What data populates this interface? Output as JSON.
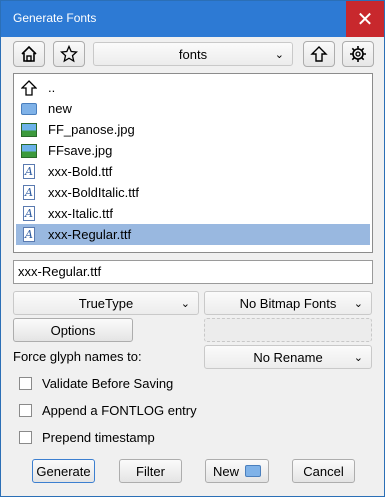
{
  "window": {
    "title": "Generate Fonts",
    "close_glyph": "✕"
  },
  "toolbar": {
    "home_icon": "home-icon",
    "bookmark_icon": "star-icon",
    "directory": "fonts",
    "up_icon": "arrow-up-icon",
    "settings_icon": "gear-icon"
  },
  "files": [
    {
      "name": "..",
      "type": "parent",
      "selected": false
    },
    {
      "name": "new",
      "type": "folder",
      "selected": false
    },
    {
      "name": "FF_panose.jpg",
      "type": "image",
      "selected": false
    },
    {
      "name": "FFsave.jpg",
      "type": "image",
      "selected": false
    },
    {
      "name": "xxx-Bold.ttf",
      "type": "font",
      "selected": false
    },
    {
      "name": "xxx-BoldItalic.ttf",
      "type": "font",
      "selected": false
    },
    {
      "name": "xxx-Italic.ttf",
      "type": "font",
      "selected": false
    },
    {
      "name": "xxx-Regular.ttf",
      "type": "font",
      "selected": true
    }
  ],
  "filename": "xxx-Regular.ttf",
  "format": {
    "outline": "TrueType",
    "bitmap": "No Bitmap Fonts"
  },
  "options_button": "Options",
  "force_glyph": {
    "label": "Force glyph names to:",
    "value": "No Rename"
  },
  "checkboxes": [
    {
      "label": "Validate Before Saving",
      "checked": false
    },
    {
      "label": "Append a FONTLOG entry",
      "checked": false
    },
    {
      "label": "Prepend timestamp",
      "checked": false
    }
  ],
  "buttons": {
    "generate": "Generate",
    "filter": "Filter",
    "new": "New",
    "cancel": "Cancel"
  },
  "colors": {
    "titlebar": "#2d7ad4",
    "close": "#c8282d",
    "selection": "#99b8e0"
  }
}
